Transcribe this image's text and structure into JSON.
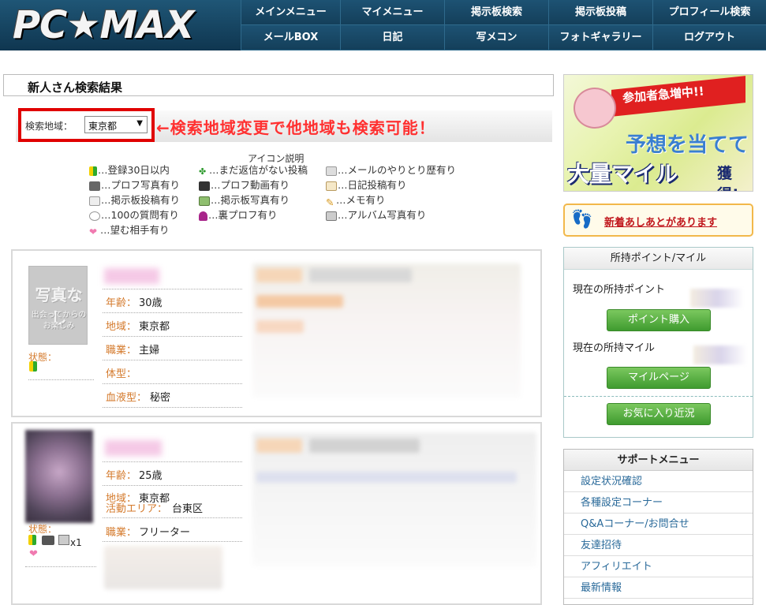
{
  "header": {
    "logo": "PC★MAX",
    "nav_row1": [
      "メインメニュー",
      "マイメニュー",
      "掲示板検索",
      "掲示板投稿",
      "プロフィール検索"
    ],
    "nav_row2": [
      "メールBOX",
      "日記",
      "写メコン",
      "フォトギャラリー",
      "ログアウト"
    ]
  },
  "main": {
    "title": "新人さん検索結果",
    "search": {
      "label": "検索地域：",
      "selected": "東京都",
      "note": "←検索地域変更で他地域も検索可能！"
    },
    "legend": {
      "title": "アイコン説明",
      "items": [
        "…登録30日以内",
        "…まだ返信がない投稿",
        "…メールのやりとり歴有り",
        "…プロフ写真有り",
        "…プロフ動画有り",
        "…日記投稿有り",
        "…掲示板投稿有り",
        "…掲示板写真有り",
        "…メモ有り",
        "…100の質問有り",
        "…裏プロフ有り",
        "…アルバム写真有り",
        "…望む相手有り"
      ]
    },
    "profiles": [
      {
        "photo_text_1": "写真なし",
        "photo_text_2": "出会ってからの",
        "photo_text_3": "お楽しみ",
        "status_label": "状態：",
        "age_label": "年齢：",
        "age": "30歳",
        "area_label": "地域：",
        "area": "東京都",
        "job_label": "職業：",
        "job": "主婦",
        "body_label": "体型：",
        "body": "",
        "blood_label": "血液型：",
        "blood": "秘密"
      },
      {
        "status_label": "状態：",
        "status_count": "x1",
        "age_label": "年齢：",
        "age": "25歳",
        "area_label": "地域：",
        "area": "東京都",
        "activity_label": "活動エリア：",
        "activity": "台東区",
        "job_label": "職業：",
        "job": "フリーター"
      }
    ]
  },
  "sidebar": {
    "banner": {
      "line1": "参加者急増中!!",
      "line2": "予想を当てて",
      "line3": "大量マイル",
      "line4": "獲得!"
    },
    "footprint": "新着あしあとがあります",
    "points": {
      "title": "所持ポイント/マイル",
      "points_label": "現在の所持ポイント",
      "buy_button": "ポイント購入",
      "miles_label": "現在の所持マイル",
      "mile_button": "マイルページ",
      "favorites_button": "お気に入り近況"
    },
    "support": {
      "title": "サポートメニュー",
      "items": [
        "設定状況確認",
        "各種設定コーナー",
        "Q&Aコーナー/お問合せ",
        "友達招待",
        "アフィリエイト",
        "最新情報"
      ]
    }
  },
  "colors": {
    "header_bg": "#15435f",
    "accent_red": "#e00000",
    "label_orange": "#d47a2c",
    "button_green": "#4fa83a",
    "link_blue": "#2a6a9a"
  }
}
